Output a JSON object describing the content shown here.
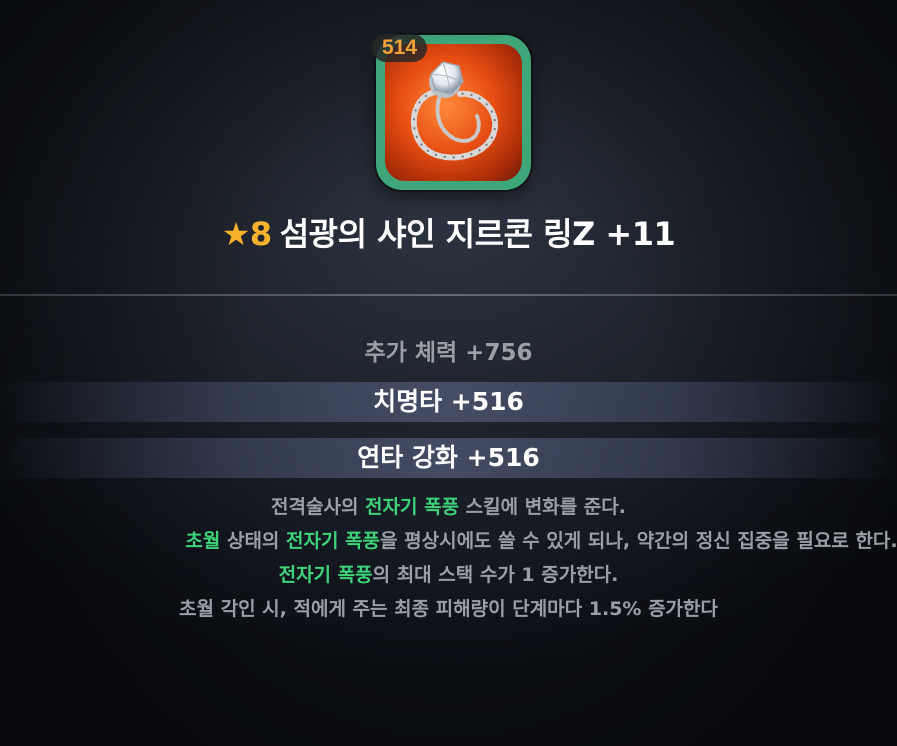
{
  "item": {
    "level_badge": "514",
    "icon": "zircon-ring-icon",
    "frame_color": "#3fa67a",
    "star_glyph": "★",
    "grade": "8",
    "name": "섬광의 샤인 지르콘 링Z +11"
  },
  "stats": {
    "base": "추가 체력 +756",
    "crit": "치명타 +516",
    "combo": "연타 강화 +516"
  },
  "description": {
    "line1": {
      "a": "전격술사의 ",
      "hl": "전자기 폭풍",
      "b": " 스킬에 변화를 준다."
    },
    "line2": {
      "hl1": "초월",
      "a": " 상태의 ",
      "hl2": "전자기 폭풍",
      "b": "을 평상시에도 쓸 수 있게 되나, 약간의 정신 집중을 필요로 한다."
    },
    "line3": {
      "hl": "전자기 폭풍",
      "a": "의 최대 스택 수가 1 증가한다."
    },
    "line4": "초월 각인 시, 적에게 주는 최종 피해량이 단계마다 1.5% 증가한다"
  },
  "colors": {
    "highlight": "#3ed27a",
    "grade": "#f4b22d",
    "level": "#f2a23a",
    "muted_text": "#9a9ea6"
  }
}
